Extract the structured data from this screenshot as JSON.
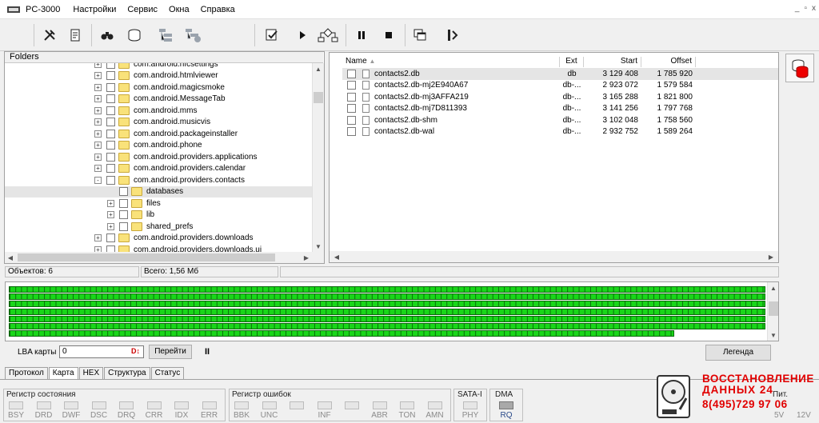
{
  "window": {
    "title": "PC-3000",
    "menu": [
      "Настройки",
      "Сервис",
      "Окна",
      "Справка"
    ],
    "controls": [
      "_",
      "▫",
      "x"
    ]
  },
  "toolbar": {
    "icons": [
      "tools-icon",
      "scroll-icon",
      "binoculars-icon",
      "database-icon",
      "tree-icon",
      "tree-gear-icon",
      "check-doc-icon",
      "play-icon",
      "flow-icon",
      "pause-icon",
      "stop-icon",
      "windows-icon",
      "exit-icon"
    ]
  },
  "folders": {
    "header": "Folders",
    "rows": [
      {
        "label": "com.android.nfcsettings",
        "level": 1,
        "exp": "+"
      },
      {
        "label": "com.android.htmlviewer",
        "level": 1,
        "exp": "+"
      },
      {
        "label": "com.android.magicsmoke",
        "level": 1,
        "exp": "+"
      },
      {
        "label": "com.android.MessageTab",
        "level": 1,
        "exp": "+"
      },
      {
        "label": "com.android.mms",
        "level": 1,
        "exp": "+"
      },
      {
        "label": "com.android.musicvis",
        "level": 1,
        "exp": "+"
      },
      {
        "label": "com.android.packageinstaller",
        "level": 1,
        "exp": "+"
      },
      {
        "label": "com.android.phone",
        "level": 1,
        "exp": "+"
      },
      {
        "label": "com.android.providers.applications",
        "level": 1,
        "exp": "+"
      },
      {
        "label": "com.android.providers.calendar",
        "level": 1,
        "exp": "+"
      },
      {
        "label": "com.android.providers.contacts",
        "level": 1,
        "exp": "-"
      },
      {
        "label": "databases",
        "level": 2,
        "exp": "",
        "selected": true
      },
      {
        "label": "files",
        "level": 2,
        "exp": "+"
      },
      {
        "label": "lib",
        "level": 2,
        "exp": "+"
      },
      {
        "label": "shared_prefs",
        "level": 2,
        "exp": "+"
      },
      {
        "label": "com.android.providers.downloads",
        "level": 1,
        "exp": "+"
      },
      {
        "label": "com.android.providers.downloads.ui",
        "level": 1,
        "exp": "+"
      }
    ]
  },
  "files": {
    "columns": {
      "name": "Name",
      "ext": "Ext",
      "start": "Start",
      "offset": "Offset"
    },
    "rows": [
      {
        "name": "contacts2.db",
        "ext": "db",
        "start": "3 129 408",
        "offset": "1 785 920",
        "selected": true
      },
      {
        "name": "contacts2.db-mj2E940A67",
        "ext": "db-...",
        "start": "2 923 072",
        "offset": "1 579 584"
      },
      {
        "name": "contacts2.db-mj3AFFA219",
        "ext": "db-...",
        "start": "3 165 288",
        "offset": "1 821 800"
      },
      {
        "name": "contacts2.db-mj7D811393",
        "ext": "db-...",
        "start": "3 141 256",
        "offset": "1 797 768"
      },
      {
        "name": "contacts2.db-shm",
        "ext": "db-...",
        "start": "3 102 048",
        "offset": "1 758 560"
      },
      {
        "name": "contacts2.db-wal",
        "ext": "db-...",
        "start": "2 932 752",
        "offset": "1 589 264"
      }
    ]
  },
  "status": {
    "objects": "Объектов: 6",
    "total": "Всего: 1,56 Мб"
  },
  "map": {
    "progress": 0.86
  },
  "lba": {
    "label": "LBA карты",
    "value": "0",
    "go": "Перейти",
    "pause": "II",
    "legend": "Легенда"
  },
  "tabs": [
    "Протокол",
    "Карта",
    "HEX",
    "Структура",
    "Статус"
  ],
  "registers": {
    "state": {
      "title": "Регистр состояния",
      "leds": [
        "BSY",
        "DRD",
        "DWF",
        "DSC",
        "DRQ",
        "CRR",
        "IDX",
        "ERR"
      ]
    },
    "errors": {
      "title": "Регистр ошибок",
      "leds": [
        "BBK",
        "UNC",
        "",
        "INF",
        "",
        "ABR",
        "TON",
        "AMN"
      ]
    },
    "sata": {
      "title": "SATA-I",
      "leds": [
        "PHY"
      ]
    },
    "dma": {
      "title": "DMA",
      "leds": [
        "RQ"
      ]
    }
  },
  "power": {
    "title": "Пит.",
    "v5": "5V",
    "v12": "12V"
  },
  "brand": {
    "line1": "ВОССТАНОВЛЕНИЕ",
    "line2": "ДАННЫХ  24",
    "line3": "8(495)729 97 06",
    "color": "#e10000"
  },
  "colors": {
    "sector_ok": "#19d619"
  }
}
